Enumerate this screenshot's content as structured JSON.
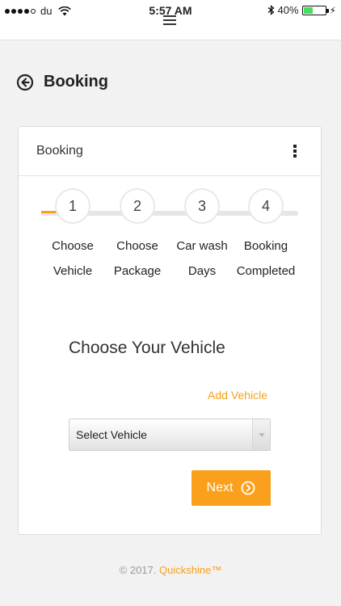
{
  "status_bar": {
    "carrier": "du",
    "time": "5:57 AM",
    "battery_percent": "40%",
    "battery_level": 0.4,
    "signal_bars": 4,
    "icons": [
      "wifi-icon",
      "bluetooth-icon",
      "battery-icon",
      "charging-bolt-icon"
    ]
  },
  "header": {
    "title": "Booking",
    "back_icon": "arrow-circle-left-icon"
  },
  "card": {
    "title": "Booking",
    "menu_icon": "kebab-menu-icon"
  },
  "stepper": {
    "progress": 0.06,
    "steps": [
      {
        "number": "1",
        "line1": "Choose",
        "line2": "Vehicle"
      },
      {
        "number": "2",
        "line1": "Choose",
        "line2": "Package"
      },
      {
        "number": "3",
        "line1": "Car wash",
        "line2": "Days"
      },
      {
        "number": "4",
        "line1": "Booking",
        "line2": "Completed"
      }
    ]
  },
  "form": {
    "section_title": "Choose Your Vehicle",
    "add_vehicle_label": "Add Vehicle",
    "select_value": "Select Vehicle",
    "next_label": "Next"
  },
  "footer": {
    "copyright": "© 2017.",
    "brand": "Quickshine™"
  },
  "colors": {
    "accent": "#fba01c",
    "background": "#f2f2f2"
  }
}
